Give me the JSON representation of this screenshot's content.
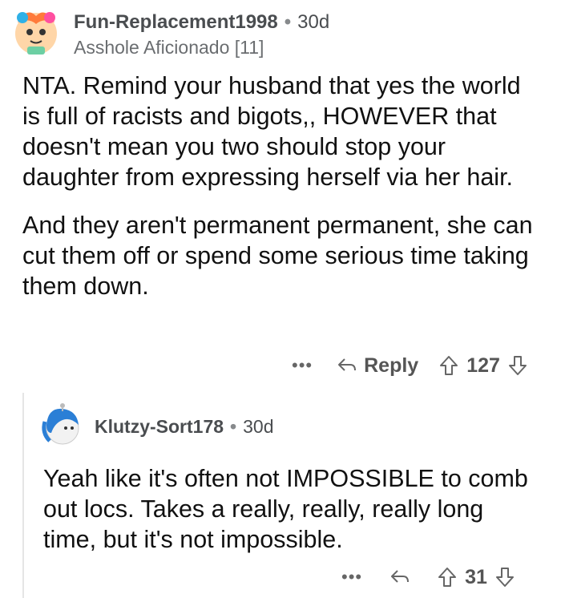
{
  "comment": {
    "username": "Fun-Replacement1998",
    "time": "30d",
    "flair": "Asshole Aficionado [11]",
    "paragraphs": [
      "NTA. Remind your husband that yes the world is full of racists and bigots,, HOWEVER that doesn't mean you two should stop your daughter from expressing herself via her hair.",
      "And they aren't permanent permanent, she can cut them off or spend some serious time taking them down."
    ],
    "more_label": "•••",
    "reply_label": "Reply",
    "score": "127",
    "icons": [
      "avatar",
      "more-icon",
      "reply-arrow-icon",
      "upvote-icon",
      "downvote-icon"
    ]
  },
  "reply": {
    "username": "Klutzy-Sort178",
    "time": "30d",
    "text": "Yeah like it's often not IMPOSSIBLE to comb out locs. Takes a really, really, really long time, but it's not impossible.",
    "more_label": "•••",
    "score": "31"
  },
  "separator": "•"
}
